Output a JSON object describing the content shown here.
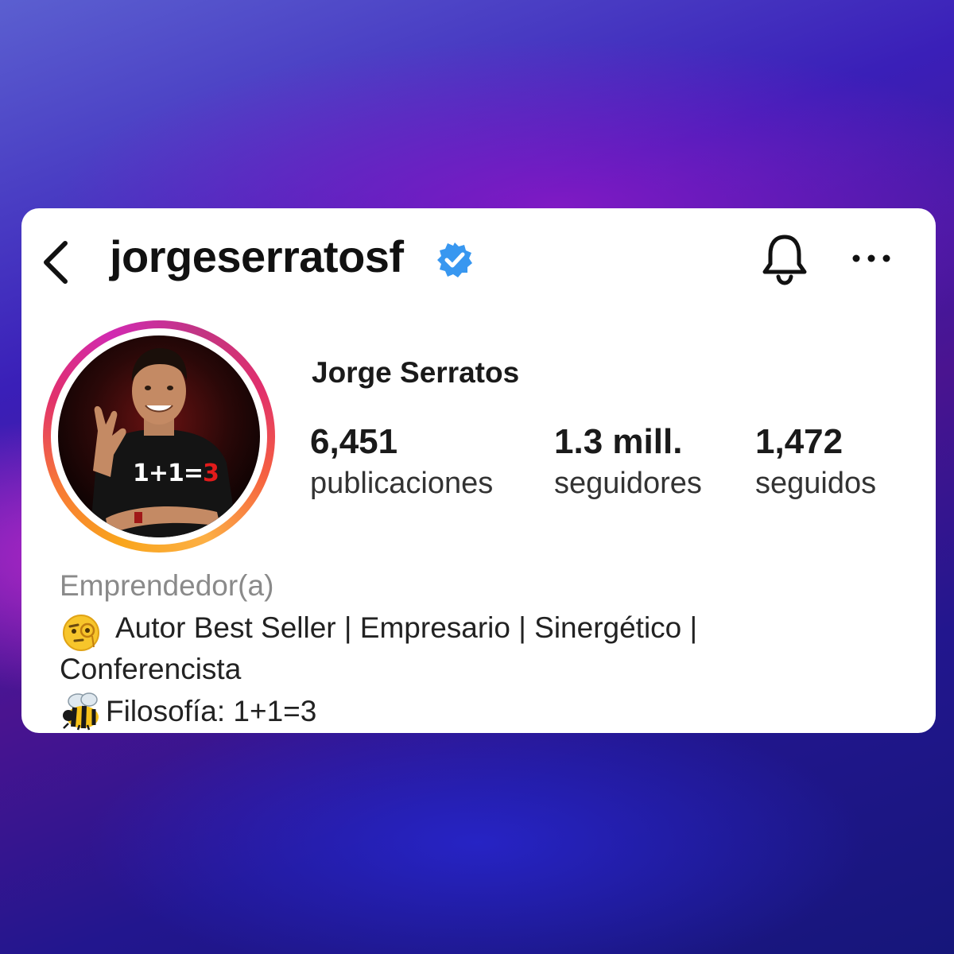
{
  "header": {
    "username": "jorgeserratosf",
    "icons": [
      "back-arrow-icon",
      "verified-badge-icon",
      "bell-icon",
      "more-options-icon"
    ],
    "verified_color": "#3897f0"
  },
  "profile": {
    "display_name": "Jorge Serratos",
    "avatar_shirt": {
      "prefix": "1+1=",
      "suffix": "3"
    },
    "stats": [
      {
        "value": "6,451",
        "label": "publicaciones"
      },
      {
        "value": "1.3 mill.",
        "label": "seguidores"
      },
      {
        "value": "1,472",
        "label": "seguidos"
      }
    ]
  },
  "bio": {
    "category": "Emprendedor(a)",
    "line1": "Autor Best Seller | Empresario | Sinergético |",
    "line2": "Conferencista",
    "line3": "Filosofía: 1+1=3",
    "emojis": [
      "face-with-monocle-icon",
      "bee-icon"
    ]
  },
  "colors": {
    "card_background": "#ffffff",
    "story_ring": [
      "#fcaf45",
      "#f77737",
      "#e1306c",
      "#c13584"
    ]
  }
}
